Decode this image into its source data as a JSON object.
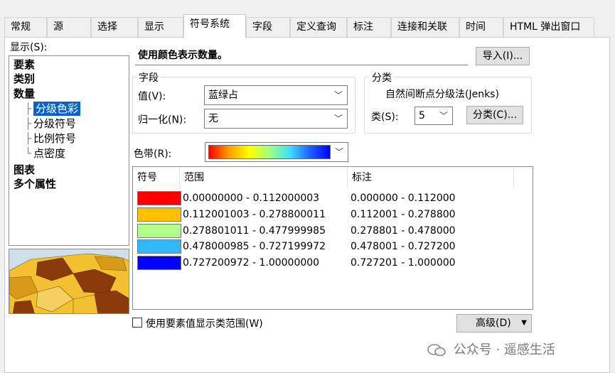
{
  "tabs": [
    "常规",
    "源",
    "选择",
    "显示",
    "符号系统",
    "字段",
    "定义查询",
    "标注",
    "连接和关联",
    "时间",
    "HTML 弹出窗口"
  ],
  "show_label": "显示(S):",
  "tree": {
    "features": "要素",
    "categories": "类别",
    "quantities": "数量",
    "graduated_colors": "分级色彩",
    "graduated_symbols": "分级符号",
    "proportional_symbols": "比例符号",
    "dot_density": "点密度",
    "charts": "图表",
    "multiple_attributes": "多个属性"
  },
  "description": "使用颜色表示数量。",
  "import_button": "导入(I)...",
  "fields_group": {
    "title": "字段",
    "value_label": "值(V):",
    "value": "蓝绿占",
    "normalization_label": "归一化(N):",
    "normalization": "无"
  },
  "classification_group": {
    "title": "分类",
    "method": "自然间断点分级法(Jenks)",
    "classes_label": "类(S):",
    "classes": "5",
    "classify_button": "分类(C)..."
  },
  "color_ramp_label": "色带(R):",
  "list": {
    "headers": {
      "symbol": "符号",
      "range": "范围",
      "label": "标注"
    },
    "rows": [
      {
        "color": "#ff0000",
        "range": "0.00000000 - 0.112000003",
        "label": "0.000000 - 0.112000"
      },
      {
        "color": "#ffc000",
        "range": "0.112001003 - 0.278800011",
        "label": "0.112001 - 0.278800"
      },
      {
        "color": "#b3ff8c",
        "range": "0.278801011 - 0.477999985",
        "label": "0.278801 - 0.478000"
      },
      {
        "color": "#33b8ff",
        "range": "0.478000985 - 0.727199972",
        "label": "0.478001 - 0.727200"
      },
      {
        "color": "#0000ff",
        "range": "0.727200972 - 1.00000000",
        "label": "0.727201 - 1.000000"
      }
    ]
  },
  "checkbox_label": "使用要素值显示类范围(W)",
  "advanced_button": "高级(D)",
  "watermark": "公众号 · 遥感生活"
}
